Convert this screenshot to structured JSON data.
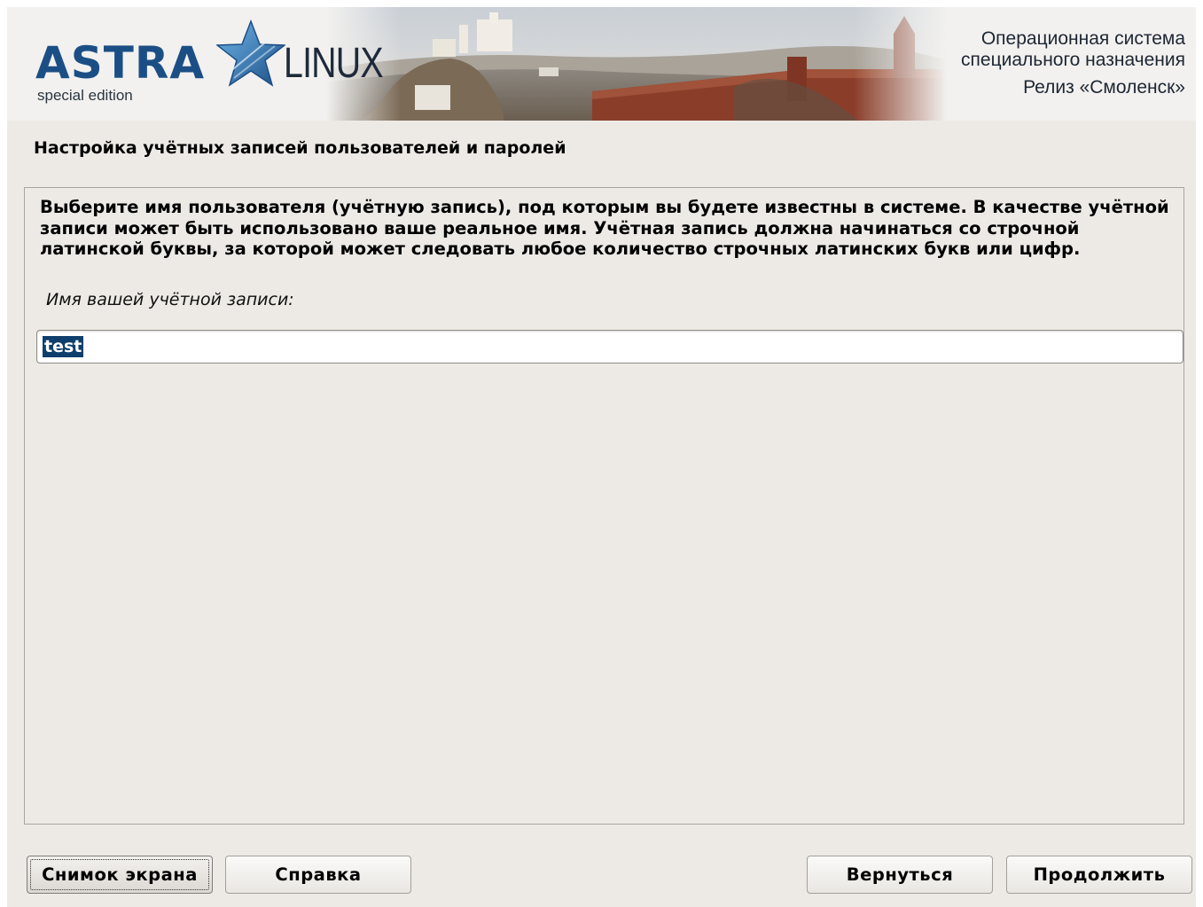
{
  "banner": {
    "logo_main": "ASTRA",
    "logo_secondary": "LINUX",
    "logo_edition": "special edition",
    "subtitle_line1": "Операционная система",
    "subtitle_line2": "специального назначения",
    "release": "Релиз «Смоленск»"
  },
  "page": {
    "title": "Настройка учётных записей пользователей и паролей",
    "description": "Выберите имя пользователя (учётную запись), под которым вы будете известны в системе. В качестве учётной записи может быть использовано ваше реальное имя. Учётная запись должна начинаться со строчной латинской буквы, за которой может следовать любое количество строчных латинских букв или цифр.",
    "field_label": "Имя вашей учётной записи:",
    "username_value": "test"
  },
  "buttons": {
    "screenshot": "Снимок экрана",
    "help": "Справка",
    "back": "Вернуться",
    "continue": "Продолжить"
  },
  "colors": {
    "background": "#edeae6",
    "logo_blue": "#1c4e86",
    "selection": "#0e3f6c"
  }
}
